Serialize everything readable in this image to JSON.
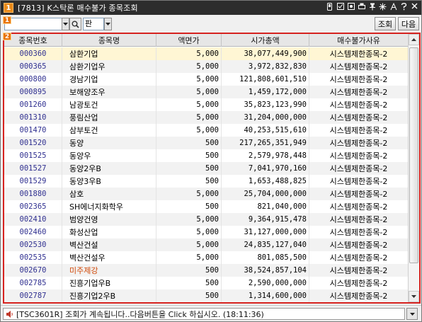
{
  "window": {
    "badge": "1",
    "title": "[7813] K스탁론 매수불가 종목조회",
    "controls": [
      "phone-icon",
      "checkbox-icon",
      "capture-icon",
      "pin-icon",
      "settings-icon",
      "font-size-icon",
      "help-icon",
      "close-icon"
    ]
  },
  "toolbar": {
    "section_badge": "1",
    "code_value": "",
    "market_label": "판",
    "query_label": "조회",
    "next_label": "다음"
  },
  "grid": {
    "section_badge": "2",
    "columns": [
      "종목번호",
      "종목명",
      "액면가",
      "시가총액",
      "매수불가사유"
    ],
    "rows": [
      {
        "code": "000360",
        "name": "삼환기업",
        "par": "5,000",
        "cap": "38,077,449,900",
        "reason": "시스템제한종목-2"
      },
      {
        "code": "000365",
        "name": "삼환기업우",
        "par": "5,000",
        "cap": "3,972,832,830",
        "reason": "시스템제한종목-2"
      },
      {
        "code": "000800",
        "name": "경남기업",
        "par": "5,000",
        "cap": "121,808,601,510",
        "reason": "시스템제한종목-2"
      },
      {
        "code": "000895",
        "name": "보해양조우",
        "par": "5,000",
        "cap": "1,459,172,000",
        "reason": "시스템제한종목-2"
      },
      {
        "code": "001260",
        "name": "남광토건",
        "par": "5,000",
        "cap": "35,823,123,990",
        "reason": "시스템제한종목-2"
      },
      {
        "code": "001310",
        "name": "풍림산업",
        "par": "5,000",
        "cap": "31,204,000,000",
        "reason": "시스템제한종목-2"
      },
      {
        "code": "001470",
        "name": "삼부토건",
        "par": "5,000",
        "cap": "40,253,515,610",
        "reason": "시스템제한종목-2"
      },
      {
        "code": "001520",
        "name": "동양",
        "par": "500",
        "cap": "217,265,351,949",
        "reason": "시스템제한종목-2"
      },
      {
        "code": "001525",
        "name": "동양우",
        "par": "500",
        "cap": "2,579,978,448",
        "reason": "시스템제한종목-2"
      },
      {
        "code": "001527",
        "name": "동양2우B",
        "par": "500",
        "cap": "7,041,970,160",
        "reason": "시스템제한종목-2"
      },
      {
        "code": "001529",
        "name": "동양3우B",
        "par": "500",
        "cap": "1,653,488,825",
        "reason": "시스템제한종목-2"
      },
      {
        "code": "001880",
        "name": "삼호",
        "par": "5,000",
        "cap": "25,704,000,000",
        "reason": "시스템제한종목-2"
      },
      {
        "code": "002365",
        "name": "SH에너지화학우",
        "par": "500",
        "cap": "821,040,000",
        "reason": "시스템제한종목-2"
      },
      {
        "code": "002410",
        "name": "범양건영",
        "par": "5,000",
        "cap": "9,364,915,478",
        "reason": "시스템제한종목-2"
      },
      {
        "code": "002460",
        "name": "화성산업",
        "par": "5,000",
        "cap": "31,127,000,000",
        "reason": "시스템제한종목-2"
      },
      {
        "code": "002530",
        "name": "벽산건설",
        "par": "5,000",
        "cap": "24,835,127,040",
        "reason": "시스템제한종목-2"
      },
      {
        "code": "002535",
        "name": "벽산건설우",
        "par": "5,000",
        "cap": "801,085,500",
        "reason": "시스템제한종목-2"
      },
      {
        "code": "002670",
        "name": "미주제강",
        "par": "500",
        "cap": "38,524,857,104",
        "reason": "시스템제한종목-2"
      },
      {
        "code": "002785",
        "name": "진흥기업우B",
        "par": "500",
        "cap": "2,590,000,000",
        "reason": "시스템제한종목-2"
      },
      {
        "code": "002787",
        "name": "진흥기업2우B",
        "par": "500",
        "cap": "1,314,600,000",
        "reason": "시스템제한종목-2"
      }
    ]
  },
  "status": {
    "icon": "speaker-icon",
    "text": "[TSC3601R] 조회가 계속됩니다..다음버튼을 Click 하십시오. (18:11:36)"
  },
  "colors": {
    "title_bg": "#2d2d2d",
    "badge_orange": "#e8740e",
    "frame_red": "#d6221f",
    "selected_row": "#fff6d4",
    "alt_row": "#f2f2f2",
    "code_blue": "#303090",
    "name_red": "#d14a0a"
  }
}
